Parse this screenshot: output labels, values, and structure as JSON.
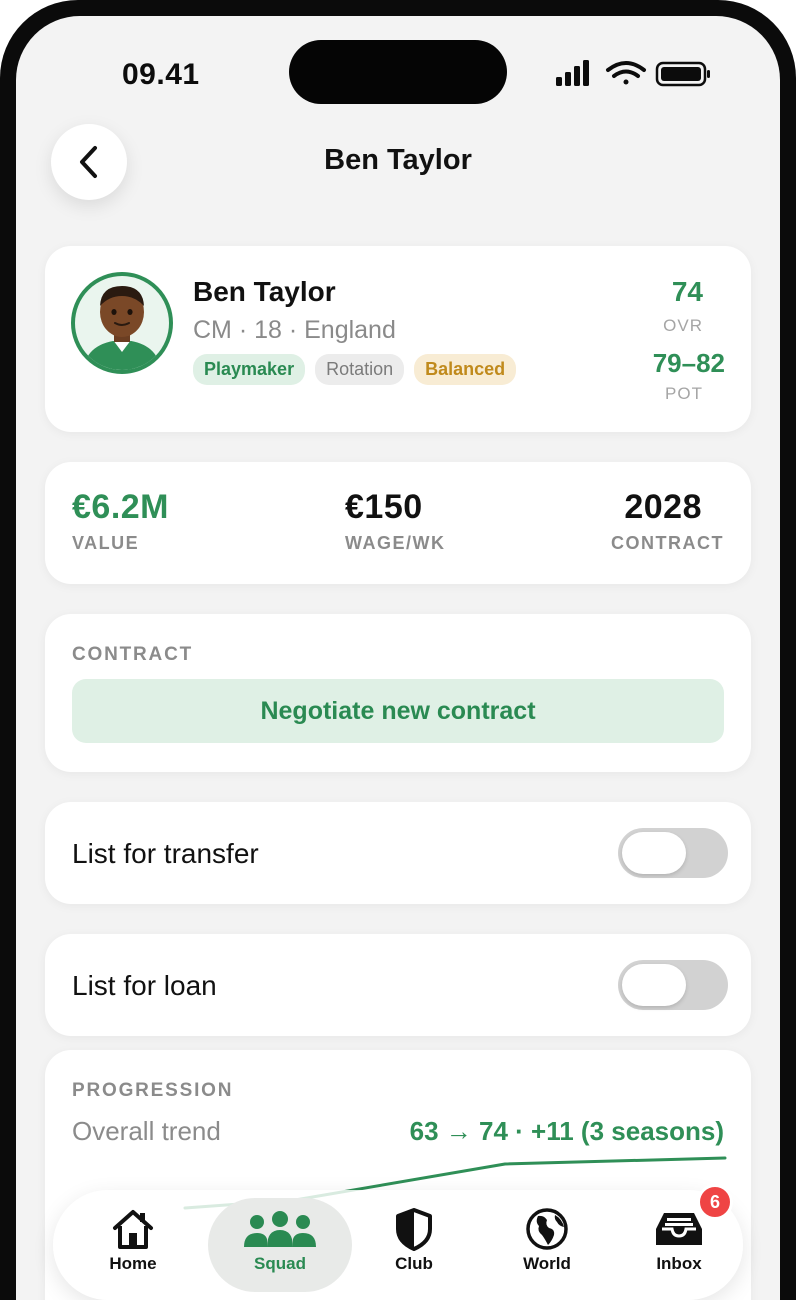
{
  "status_bar": {
    "time": "09.41"
  },
  "header": {
    "title": "Ben Taylor",
    "back_icon": "chevron-left-icon"
  },
  "player": {
    "name": "Ben Taylor",
    "meta": "CM · 18 · England",
    "tags": [
      "Playmaker",
      "Rotation",
      "Balanced"
    ],
    "ovr": {
      "value": "74",
      "label": "OVR"
    },
    "pot": {
      "value": "79–82",
      "label": "POT"
    }
  },
  "stats": {
    "value": {
      "value": "€6.2M",
      "label": "VALUE"
    },
    "wage": {
      "value": "€150",
      "label": "WAGE/WK"
    },
    "contract": {
      "value": "2028",
      "label": "CONTRACT"
    }
  },
  "contract_section": {
    "label": "CONTRACT",
    "button_label": "Negotiate new contract"
  },
  "toggles": [
    {
      "label": "List for transfer",
      "on": false
    },
    {
      "label": "List for loan",
      "on": false
    }
  ],
  "progression": {
    "label": "PROGRESSION",
    "trend_label": "Overall trend",
    "trend_value": "63 → 74 · +11 (3 seasons)"
  },
  "tab_bar": {
    "tabs": [
      {
        "label": "Home",
        "icon": "home-icon",
        "active": false
      },
      {
        "label": "Squad",
        "icon": "people-icon",
        "active": true
      },
      {
        "label": "Club",
        "icon": "shield-icon",
        "active": false
      },
      {
        "label": "World",
        "icon": "globe-icon",
        "active": false
      },
      {
        "label": "Inbox",
        "icon": "inbox-icon",
        "active": false,
        "badge": "6"
      }
    ]
  },
  "colors": {
    "accent": "#2f8f57",
    "badge": "#ef4444",
    "amber": "#c08a1c"
  }
}
